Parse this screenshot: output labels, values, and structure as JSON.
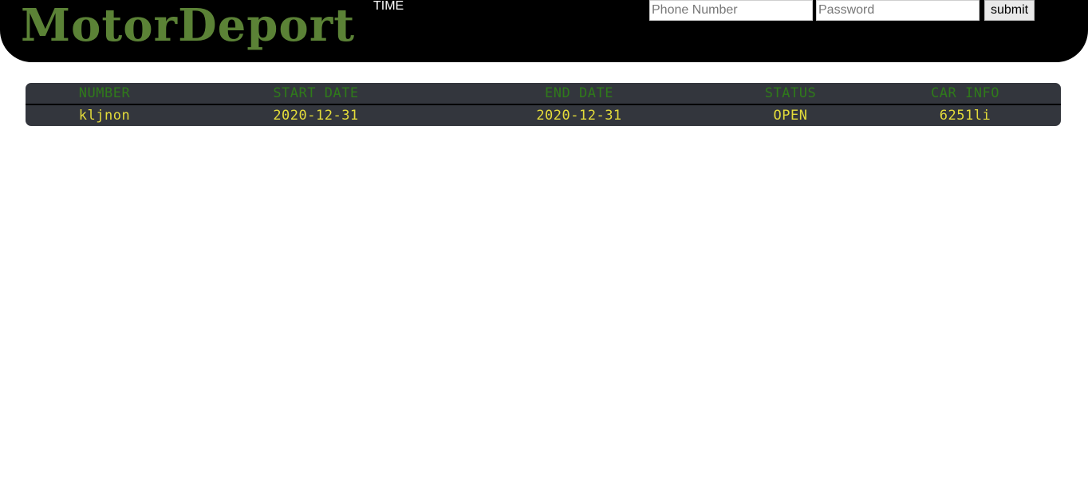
{
  "header": {
    "logo_text": "MotorDeport",
    "time_label": "TIME",
    "login": {
      "phone_placeholder": "Phone Number",
      "password_placeholder": "Password",
      "submit_label": "submit"
    }
  },
  "table": {
    "columns": [
      "NUMBER",
      "START DATE",
      "END DATE",
      "STATUS",
      "CAR INFO"
    ],
    "rows": [
      [
        "kljnon",
        "2020-12-31",
        "2020-12-31",
        "OPEN",
        "6251li"
      ]
    ]
  },
  "colors": {
    "header_bg": "#000000",
    "logo": "#5b8236",
    "table_bg": "#33363d",
    "column_header_text": "#2f7a1a",
    "cell_text": "#e4dc3a"
  }
}
